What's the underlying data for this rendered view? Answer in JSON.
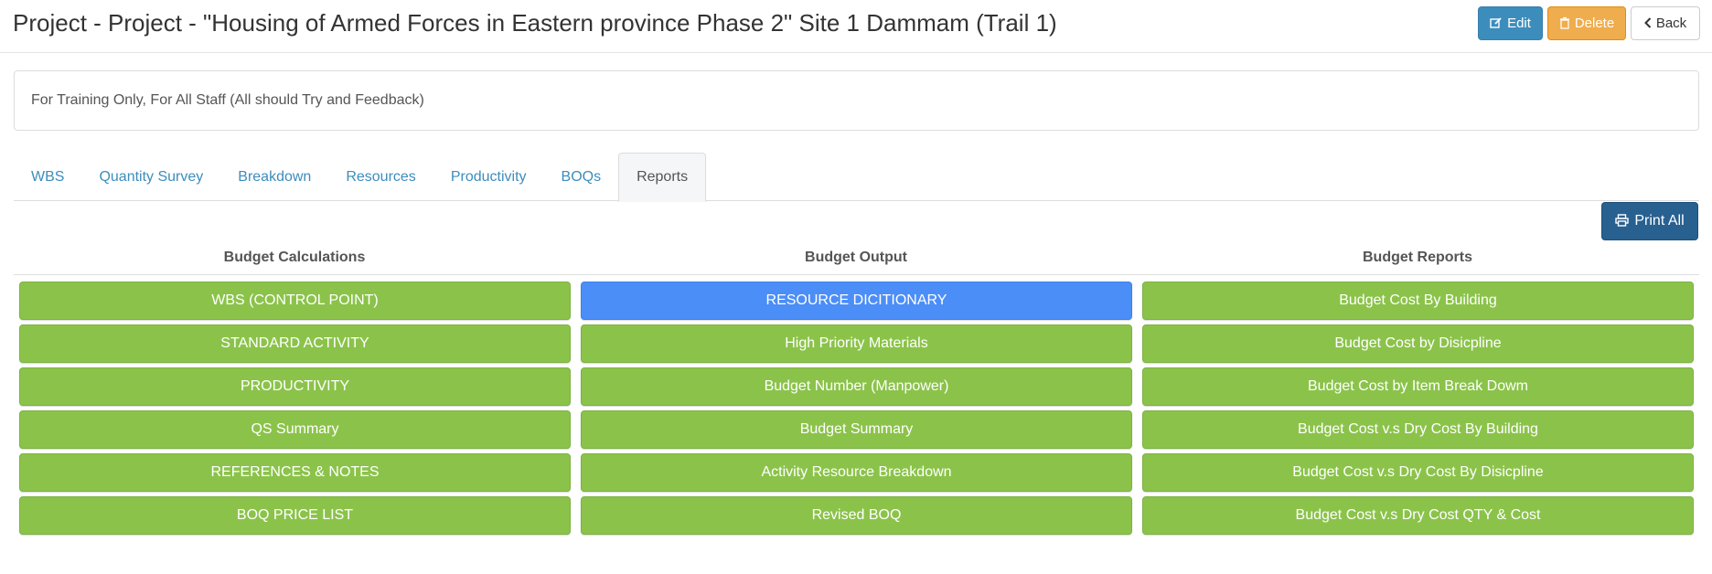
{
  "header": {
    "title": "Project - Project - \"Housing of Armed Forces in Eastern province Phase 2\" Site 1 Dammam (Trail 1)",
    "edit_label": "Edit",
    "delete_label": "Delete",
    "back_label": "Back"
  },
  "notice": {
    "text": "For Training Only, For All Staff (All should Try and Feedback)"
  },
  "tabs": [
    {
      "label": "WBS"
    },
    {
      "label": "Quantity Survey"
    },
    {
      "label": "Breakdown"
    },
    {
      "label": "Resources"
    },
    {
      "label": "Productivity"
    },
    {
      "label": "BOQs"
    },
    {
      "label": "Reports",
      "active": true
    }
  ],
  "print_all_label": "Print All",
  "columns": [
    {
      "heading": "Budget Calculations",
      "buttons": [
        {
          "label": "WBS (CONTROL POINT)"
        },
        {
          "label": "STANDARD ACTIVITY"
        },
        {
          "label": "PRODUCTIVITY"
        },
        {
          "label": "QS Summary"
        },
        {
          "label": "REFERENCES & NOTES"
        },
        {
          "label": "BOQ PRICE LIST"
        }
      ]
    },
    {
      "heading": "Budget Output",
      "buttons": [
        {
          "label": "RESOURCE DICITIONARY",
          "highlight": true
        },
        {
          "label": "High Priority Materials"
        },
        {
          "label": "Budget Number (Manpower)"
        },
        {
          "label": "Budget Summary"
        },
        {
          "label": "Activity Resource Breakdown"
        },
        {
          "label": "Revised BOQ"
        }
      ]
    },
    {
      "heading": "Budget Reports",
      "buttons": [
        {
          "label": "Budget Cost By Building"
        },
        {
          "label": "Budget Cost by Disicpline"
        },
        {
          "label": "Budget Cost by Item Break Dowm"
        },
        {
          "label": "Budget Cost v.s Dry Cost By Building"
        },
        {
          "label": "Budget Cost v.s Dry Cost By Disicpline"
        },
        {
          "label": "Budget Cost v.s Dry Cost QTY & Cost"
        }
      ]
    }
  ],
  "colors": {
    "primary": "#3c8dbc",
    "warning": "#f0ad4e",
    "report_green": "#8bc34a",
    "report_blue": "#4c8ef7",
    "print_blue": "#286090"
  }
}
